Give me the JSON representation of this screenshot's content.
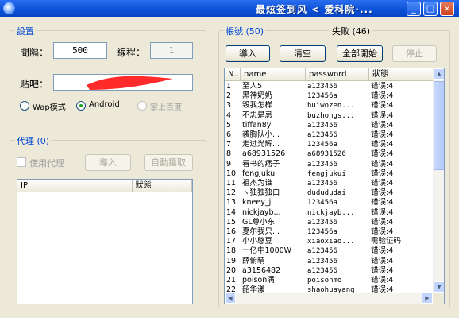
{
  "window": {
    "title": "最炫签到风 < 爱科院·..."
  },
  "settings": {
    "group_label": "設置",
    "interval_label": "間隔：",
    "interval_value": "500",
    "threads_label": "線程：",
    "threads_value": "1",
    "tieba_label": "贴吧：",
    "tieba_value": "",
    "modes": [
      {
        "label": "Wap模式",
        "checked": false,
        "disabled": false
      },
      {
        "label": "Android",
        "checked": true,
        "disabled": false
      },
      {
        "label": "掌上百度",
        "checked": false,
        "disabled": true
      }
    ]
  },
  "proxy": {
    "group_label": "代理 (0)",
    "use_proxy_label": "使用代理",
    "import_label": "導入",
    "auto_fetch_label": "自動獲取",
    "columns": [
      "IP",
      "狀態"
    ]
  },
  "accounts": {
    "group_label": "帳號 (50)",
    "failed_label": "失败 (46)",
    "buttons": {
      "import": "導入",
      "clear": "清空",
      "start_all": "全部開始",
      "stop": "停止"
    },
    "columns": [
      "N..",
      "name",
      "password",
      "狀態"
    ],
    "rows": [
      {
        "n": "1",
        "name": "至人5",
        "password": "a123456",
        "status": "错误:4"
      },
      {
        "n": "2",
        "name": "黑神奶奶",
        "password": "123456a",
        "status": "错误:4"
      },
      {
        "n": "3",
        "name": "毁我怎样",
        "password": "huiwozen...",
        "status": "错误:4"
      },
      {
        "n": "4",
        "name": "不忠是忌",
        "password": "buzhongs...",
        "status": "错误:4"
      },
      {
        "n": "5",
        "name": "tiffan8y",
        "password": "a123456",
        "status": "错误:4"
      },
      {
        "n": "6",
        "name": "袭胸队小...",
        "password": "a123456",
        "status": "错误:4"
      },
      {
        "n": "7",
        "name": "走过光辉...",
        "password": "123456a",
        "status": "错误:4"
      },
      {
        "n": "8",
        "name": "a68931526",
        "password": "a68931526",
        "status": "错误:4"
      },
      {
        "n": "9",
        "name": "看书的痞子",
        "password": "a123456",
        "status": "错误:4"
      },
      {
        "n": "10",
        "name": "fengjukui",
        "password": "fengjukui",
        "status": "错误:4"
      },
      {
        "n": "11",
        "name": "祖杰为谁",
        "password": "a123456",
        "status": "错误:4"
      },
      {
        "n": "12",
        "name": "ヽ独独独白",
        "password": "dudududai",
        "status": "错误:4"
      },
      {
        "n": "13",
        "name": "kneey_ji",
        "password": "123456a",
        "status": "错误:4"
      },
      {
        "n": "14",
        "name": "nickjayb...",
        "password": "nickjayb...",
        "status": "错误:4"
      },
      {
        "n": "15",
        "name": "GL尊小东",
        "password": "a123456",
        "status": "错误:4"
      },
      {
        "n": "16",
        "name": "夏尔我只...",
        "password": "123456a",
        "status": "错误:4"
      },
      {
        "n": "17",
        "name": "小小憨豆",
        "password": "xiaoxiao...",
        "status": "需验证码"
      },
      {
        "n": "18",
        "name": "一亿中1000W",
        "password": "a123456",
        "status": "错误:4"
      },
      {
        "n": "19",
        "name": "薛俯晴",
        "password": "a123456",
        "status": "错误:4"
      },
      {
        "n": "20",
        "name": "a3156482",
        "password": "a123456",
        "status": "错误:4"
      },
      {
        "n": "21",
        "name": "poison满",
        "password": "poisonmo",
        "status": "错误:4"
      },
      {
        "n": "22",
        "name": "韶华漾",
        "password": "shaohuayang",
        "status": "错误:4"
      }
    ]
  },
  "colors": {
    "group_label": "#0046d5",
    "redaction": "#ff2a2a"
  }
}
